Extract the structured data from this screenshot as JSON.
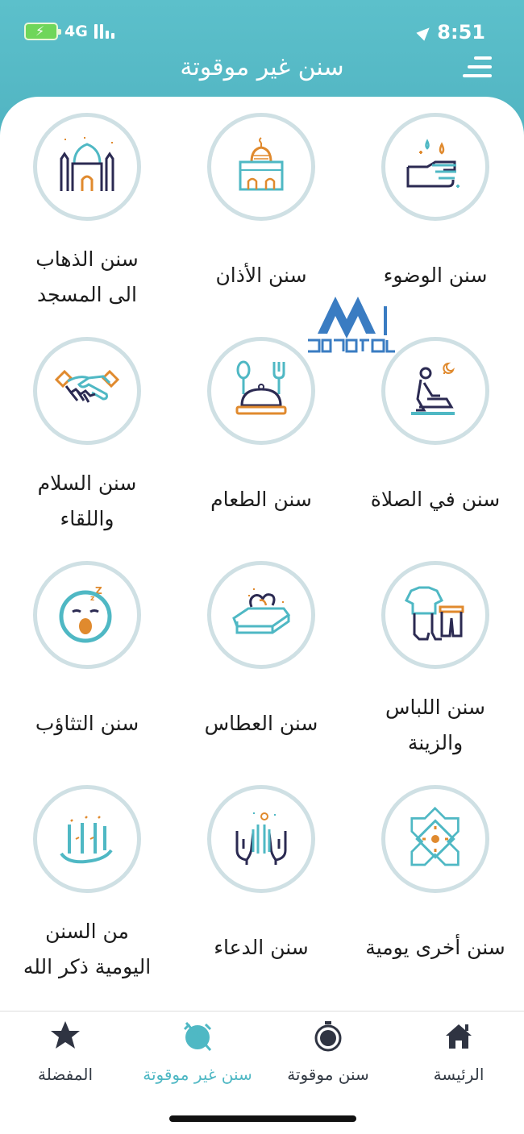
{
  "status": {
    "network": "4G",
    "time": "8:51"
  },
  "header": {
    "title": "سنن غير موقوتة"
  },
  "colors": {
    "accent": "#4fb8c4",
    "header_bg": "#5cc0cb",
    "icon_orange": "#e08a2e",
    "icon_navy": "#2b2a52",
    "circle_border": "#cfe0e4"
  },
  "items": [
    {
      "label": "سنن الوضوء",
      "icon": "washing-hands-icon"
    },
    {
      "label": "سنن الأذان",
      "icon": "mosque-icon"
    },
    {
      "label": "سنن الذهاب\nالى المسجد",
      "icon": "mosque-towers-icon"
    },
    {
      "label": "سنن في الصلاة",
      "icon": "praying-person-icon"
    },
    {
      "label": "سنن الطعام",
      "icon": "food-dish-icon"
    },
    {
      "label": "سنن السلام\nواللقاء",
      "icon": "handshake-icon"
    },
    {
      "label": "سنن اللباس\nوالزينة",
      "icon": "clothing-icon"
    },
    {
      "label": "سنن العطاس",
      "icon": "tissue-box-icon"
    },
    {
      "label": "سنن التثاؤب",
      "icon": "yawning-face-icon"
    },
    {
      "label": "سنن أخرى يومية",
      "icon": "islamic-pattern-icon"
    },
    {
      "label": "سنن الدعاء",
      "icon": "dua-hands-icon"
    },
    {
      "label": "من السنن\nاليومية ذكر الله",
      "icon": "allah-calligraphy-icon"
    }
  ],
  "tabs": [
    {
      "label": "الرئيسة",
      "icon": "home-icon",
      "active": false
    },
    {
      "label": "سنن موقوتة",
      "icon": "stopwatch-icon",
      "active": false
    },
    {
      "label": "سنن غير موقوتة",
      "icon": "alarm-off-icon",
      "active": true
    },
    {
      "label": "المفضلة",
      "icon": "star-icon",
      "active": false
    }
  ]
}
